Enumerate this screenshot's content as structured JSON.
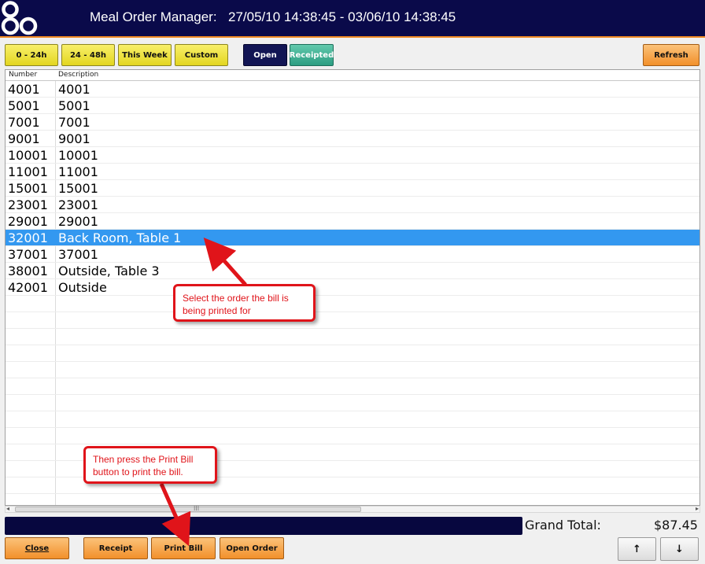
{
  "header": {
    "title": "Meal Order Manager:",
    "date_range": "27/05/10 14:38:45 - 03/06/10 14:38:45",
    "logo_icon": "three-ring-logo-icon"
  },
  "toolbar": {
    "filter_0_24": "0 - 24h",
    "filter_24_48": "24 - 48h",
    "filter_week": "This Week",
    "filter_custom": "Custom",
    "open_label": "Open",
    "receipted_label": "Receipted",
    "refresh_label": "Refresh"
  },
  "grid": {
    "columns": [
      "Number",
      "Description"
    ],
    "rows": [
      {
        "number": "4001",
        "description": "4001"
      },
      {
        "number": "5001",
        "description": "5001"
      },
      {
        "number": "7001",
        "description": "7001"
      },
      {
        "number": "9001",
        "description": "9001"
      },
      {
        "number": "10001",
        "description": "10001"
      },
      {
        "number": "11001",
        "description": "11001"
      },
      {
        "number": "15001",
        "description": "15001"
      },
      {
        "number": "23001",
        "description": "23001"
      },
      {
        "number": "29001",
        "description": "29001"
      },
      {
        "number": "32001",
        "description": "Back Room, Table 1"
      },
      {
        "number": "37001",
        "description": "37001"
      },
      {
        "number": "38001",
        "description": "Outside, Table 3"
      },
      {
        "number": "42001",
        "description": "Outside"
      }
    ],
    "selected_row": 9,
    "scroll_grip": "III"
  },
  "totals": {
    "label": "Grand Total:",
    "value": "$87.45"
  },
  "bottom": {
    "close_label": "Close",
    "receipt_label": "Receipt",
    "print_bill_label": "Print Bill",
    "open_order_label": "Open Order",
    "up_arrow": "↑",
    "down_arrow": "↓"
  },
  "annotations": {
    "select_order": "Select the order the bill is being printed for",
    "press_print": "Then press the Print Bill button to print the bill."
  },
  "colors": {
    "header_bg": "#0a0a4a",
    "selected_row": "#3398f0",
    "callout_red": "#e0141a",
    "accent_orange": "#f2902a"
  }
}
